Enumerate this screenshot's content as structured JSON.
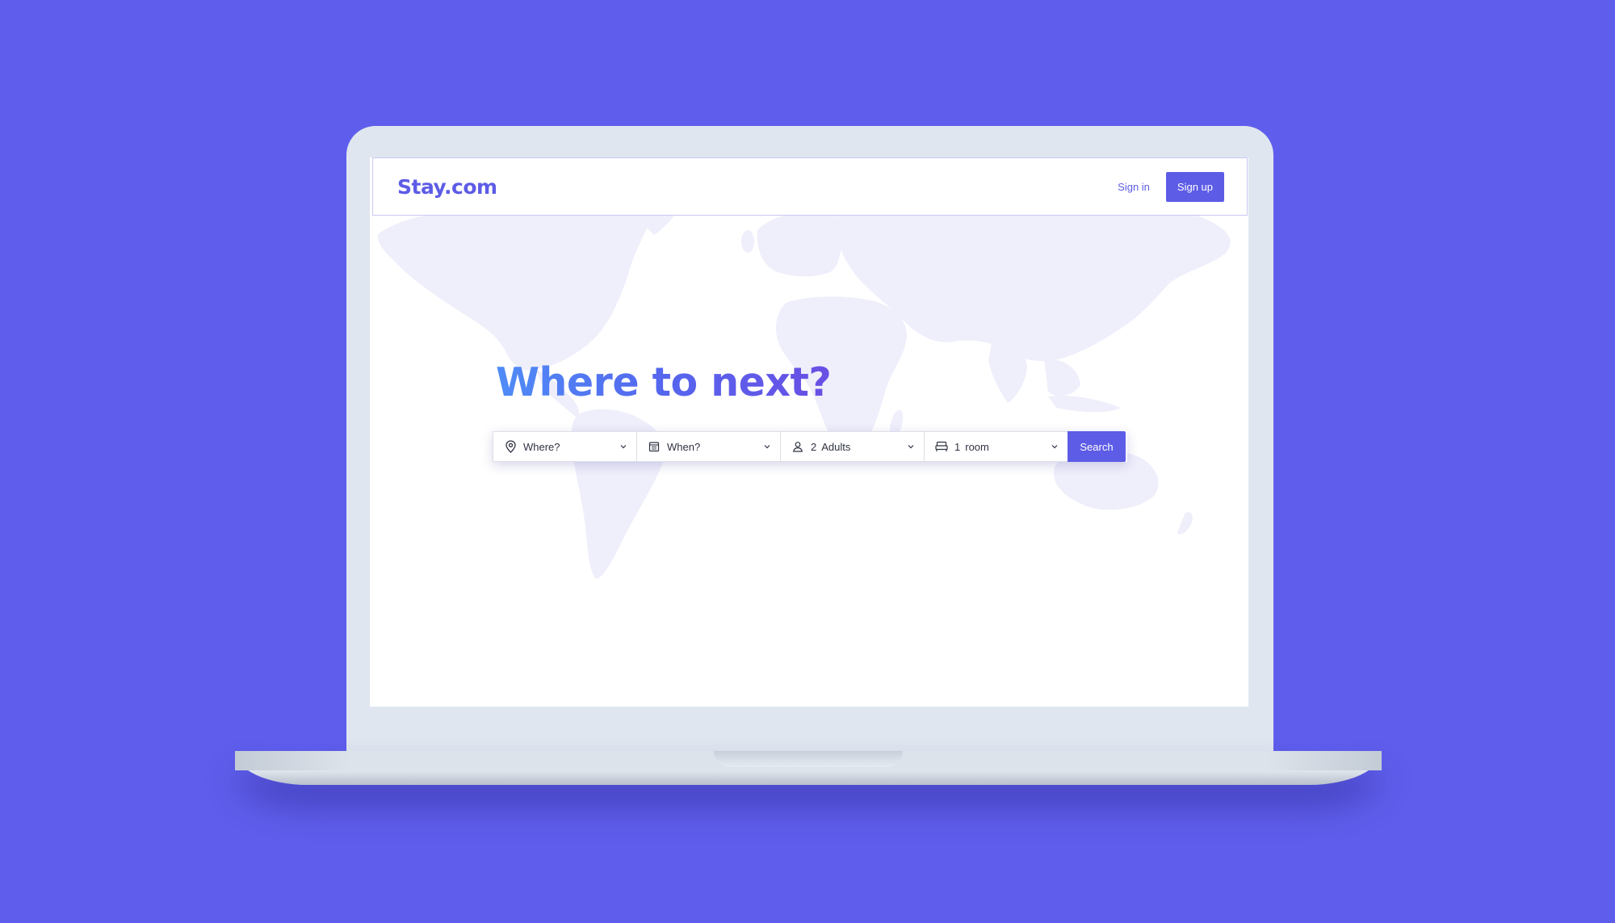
{
  "brand": {
    "name": "Stay.com"
  },
  "header": {
    "signin_label": "Sign in",
    "signup_label": "Sign up"
  },
  "hero": {
    "title": "Where to next?"
  },
  "search": {
    "where": {
      "placeholder": "Where?",
      "icon": "location-pin-icon"
    },
    "when": {
      "placeholder": "When?",
      "icon": "calendar-icon"
    },
    "guests": {
      "count": "2",
      "unit": "Adults",
      "icon": "person-icon"
    },
    "rooms": {
      "count": "1",
      "unit": "room",
      "icon": "bed-icon"
    },
    "button_label": "Search"
  },
  "colors": {
    "background": "#5f5eec",
    "accent": "#5d5ce6",
    "title_gradient_start": "#4f8cf6",
    "title_gradient_end": "#6a4fe4",
    "map_fill": "#efeefb"
  }
}
